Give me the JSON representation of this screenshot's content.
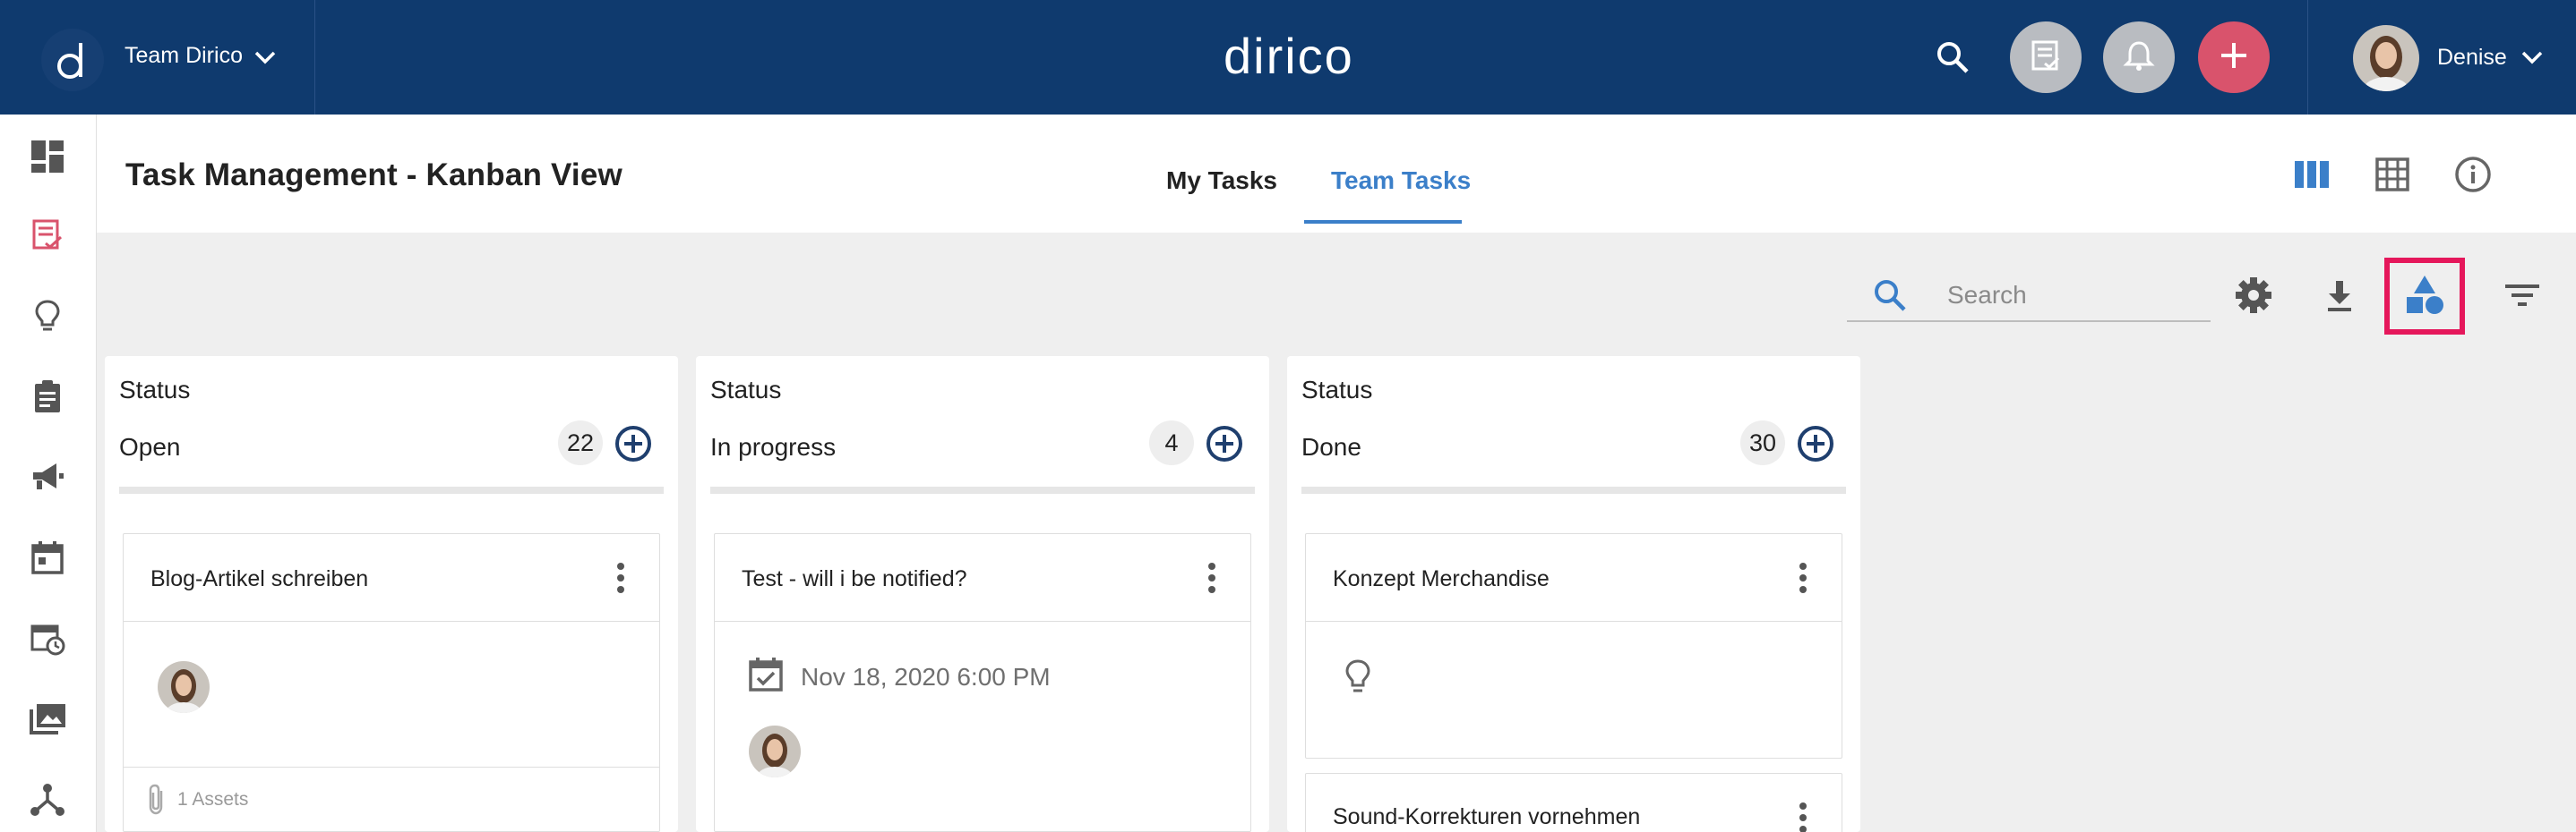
{
  "topbar": {
    "team_name": "Team Dirico",
    "brand": "dirico",
    "user_name": "Denise",
    "colors": {
      "bar": "#0f3a6e",
      "plus_button": "#d9536c",
      "gray_button": "#b9bcc1"
    }
  },
  "header": {
    "title": "Task Management - Kanban View",
    "tabs": [
      {
        "label": "My Tasks",
        "active": false
      },
      {
        "label": "Team Tasks",
        "active": true
      }
    ]
  },
  "toolbar": {
    "search_placeholder": "Search"
  },
  "columns": [
    {
      "group_label": "Status",
      "name": "Open",
      "count": "22",
      "cards": [
        {
          "title": "Blog-Artikel schreiben",
          "assets": "1 Assets"
        }
      ]
    },
    {
      "group_label": "Status",
      "name": "In progress",
      "count": "4",
      "cards": [
        {
          "title": "Test - will i be notified?",
          "due": "Nov 18, 2020 6:00 PM"
        }
      ]
    },
    {
      "group_label": "Status",
      "name": "Done",
      "count": "30",
      "cards": [
        {
          "title": "Konzept Merchandise"
        },
        {
          "title": "Sound-Korrekturen vornehmen"
        }
      ]
    }
  ],
  "accent_colors": {
    "primary_blue": "#3b7fc9",
    "highlight": "#e5175b",
    "sidebar_active": "#d9536c"
  }
}
